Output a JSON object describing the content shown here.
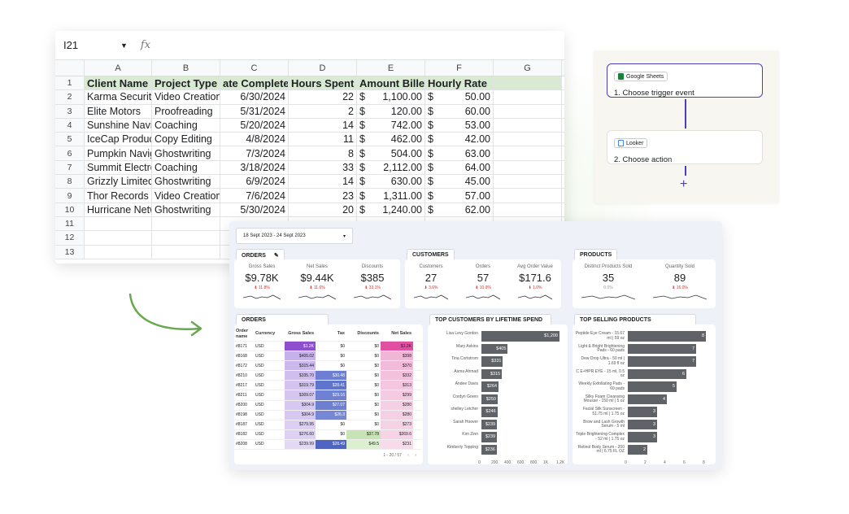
{
  "sheet": {
    "cell_ref": "I21",
    "fx": "fx",
    "columns": [
      "A",
      "B",
      "C",
      "D",
      "E",
      "F",
      "G"
    ],
    "header_row": {
      "num": "1",
      "cells": [
        "Client Name",
        "Project Type",
        "ate Complete",
        "Hours Spent",
        "Amount Billec",
        "Hourly Rate"
      ]
    },
    "rows": [
      {
        "num": "2",
        "client": "Karma Security",
        "type": "Video Creation",
        "date": "6/30/2024",
        "hours": "22",
        "amount": "1,100.00",
        "rate": "50.00"
      },
      {
        "num": "3",
        "client": "Elite Motors",
        "type": "Proofreading",
        "date": "5/31/2024",
        "hours": "2",
        "amount": "120.00",
        "rate": "60.00"
      },
      {
        "num": "4",
        "client": "Sunshine Naviga",
        "type": "Coaching",
        "date": "5/20/2024",
        "hours": "14",
        "amount": "742.00",
        "rate": "53.00"
      },
      {
        "num": "5",
        "client": "IceCap Producti",
        "type": "Copy Editing",
        "date": "4/8/2024",
        "hours": "11",
        "amount": "462.00",
        "rate": "42.00"
      },
      {
        "num": "6",
        "client": "Pumpkin Naviga",
        "type": "Ghostwriting",
        "date": "7/3/2024",
        "hours": "8",
        "amount": "504.00",
        "rate": "63.00"
      },
      {
        "num": "7",
        "client": "Summit Electron",
        "type": "Coaching",
        "date": "3/18/2024",
        "hours": "33",
        "amount": "2,112.00",
        "rate": "64.00"
      },
      {
        "num": "8",
        "client": "Grizzly Limited",
        "type": "Ghostwriting",
        "date": "6/9/2024",
        "hours": "14",
        "amount": "630.00",
        "rate": "45.00"
      },
      {
        "num": "9",
        "client": "Thor Records",
        "type": "Video Creation",
        "date": "7/6/2024",
        "hours": "23",
        "amount": "1,311.00",
        "rate": "57.00"
      },
      {
        "num": "10",
        "client": "Hurricane Netwo",
        "type": "Ghostwriting",
        "date": "5/30/2024",
        "hours": "20",
        "amount": "1,240.00",
        "rate": "62.00"
      }
    ],
    "empty_rows": [
      "11",
      "12",
      "13"
    ],
    "currency": "$"
  },
  "flow": {
    "step1": {
      "app": "Google Sheets",
      "label": "1. Choose trigger event",
      "icon_color": "#188038"
    },
    "step2": {
      "app": "Looker",
      "label": "2. Choose action",
      "icon_color": "#4285f4"
    },
    "plus": "+"
  },
  "dash": {
    "date_range": "18 Sept 2023 - 24 Sept 2023",
    "orders_kpi": {
      "tab": "ORDERS",
      "items": [
        {
          "label": "Gross Sales",
          "value": "$9.78K",
          "delta": "11.8%"
        },
        {
          "label": "Net Sales",
          "value": "$9.44K",
          "delta": "11.6%"
        },
        {
          "label": "Discounts",
          "value": "$385",
          "delta": "33.1%"
        }
      ]
    },
    "customers_kpi": {
      "tab": "CUSTOMERS",
      "items": [
        {
          "label": "Customers",
          "value": "27",
          "delta": "3.6%"
        },
        {
          "label": "Orders",
          "value": "57",
          "delta": "10.9%"
        },
        {
          "label": "Avg Order Value",
          "value": "$171.6",
          "delta": "1.0%"
        }
      ]
    },
    "products_kpi": {
      "tab": "PRODUCTS",
      "items": [
        {
          "label": "Distinct Products Sold",
          "value": "35",
          "delta": "0.0%"
        },
        {
          "label": "Quantity Sold",
          "value": "89",
          "delta": "16.0%"
        }
      ]
    },
    "orders_table": {
      "tab": "ORDERS",
      "headers": [
        "Order name",
        "Currency",
        "Gross Sales",
        "Tax",
        "Discounts",
        "Net Sales"
      ],
      "rows": [
        [
          "#8171",
          "USD",
          "$1.2K",
          "$0",
          "$0",
          "$1.2K"
        ],
        [
          "#8168",
          "USD",
          "$405.02",
          "$0",
          "$0",
          "$398"
        ],
        [
          "#8172",
          "USD",
          "$315.44",
          "$0",
          "$0",
          "$370"
        ],
        [
          "#8210",
          "USD",
          "$335.70",
          "$30.48",
          "$0",
          "$332"
        ],
        [
          "#8217",
          "USD",
          "$319.79",
          "$28.41",
          "$0",
          "$313"
        ],
        [
          "#8211",
          "USD",
          "$309.07",
          "$29.16",
          "$0",
          "$299"
        ],
        [
          "#8200",
          "USD",
          "$304.9",
          "$27.07",
          "$0",
          "$280"
        ],
        [
          "#8198",
          "USD",
          "$304.9",
          "$26.3",
          "$0",
          "$280"
        ],
        [
          "#8187",
          "USD",
          "$279.95",
          "$0",
          "$0",
          "$273"
        ],
        [
          "#8182",
          "USD",
          "$276.60",
          "$0",
          "$37.78",
          "$269.6"
        ],
        [
          "#8208",
          "USD",
          "$239.99",
          "$28.49",
          "$49.5",
          "$231"
        ]
      ],
      "pager": "1 - 20 / 57"
    },
    "top_customers": {
      "tab": "TOP CUSTOMERS BY LIFETIME SPEND",
      "chart_data": {
        "type": "bar",
        "orientation": "horizontal",
        "categories": [
          "Lisa Levy Gordon",
          "Mary Askins",
          "Tina Cortstrom",
          "Asma Ahmad",
          "Andee Davis",
          "Cordyn Goren",
          "shelley Letcher",
          "Sarah Hoover",
          "Kim Zinn",
          "Kimberly Topping"
        ],
        "values": [
          1200,
          405,
          331,
          315,
          264,
          250,
          246,
          239,
          239,
          236
        ],
        "value_labels": [
          "$1,200",
          "$405",
          "$331",
          "$315",
          "$264",
          "$250",
          "$246",
          "$239",
          "$239",
          "$236"
        ],
        "xticks": [
          "0",
          "200",
          "400",
          "600",
          "800",
          "1K",
          "1.2K"
        ],
        "xlim": [
          0,
          1200
        ]
      }
    },
    "top_products": {
      "tab": "TOP SELLING PRODUCTS",
      "chart_data": {
        "type": "bar",
        "orientation": "horizontal",
        "categories": [
          "Peptide Eye Cream - 15.67 ml | 59 oz",
          "Light & Bright Brightening Pads - 60 pads",
          "Dew Drop Ultra - 50 ml | 1.69 fl oz",
          "C E+HPR EYE - 15 ml, 0.5 oz",
          "Weekly Exfoliating Pads - 60 pads",
          "Silky Foam Cleansing Mousse - 150 ml | 5 oz",
          "Facial Silk Sunscreen - 51.75 ml | 1.75 oz",
          "Brow and Lash Growth Serum - 5 ml",
          "Triple Brightening Complex - 52 ml | 1.75 oz",
          "Retinol Body Serum - 200 ml | 6.75 FL OZ"
        ],
        "values": [
          8,
          7,
          7,
          6,
          5,
          4,
          3,
          3,
          3,
          2
        ],
        "value_labels": [
          "8",
          "7",
          "7",
          "6",
          "5",
          "4",
          "3",
          "3",
          "3",
          "2"
        ],
        "xticks": [
          "0",
          "2",
          "4",
          "6",
          "8"
        ],
        "xlim": [
          0,
          8
        ]
      }
    }
  }
}
